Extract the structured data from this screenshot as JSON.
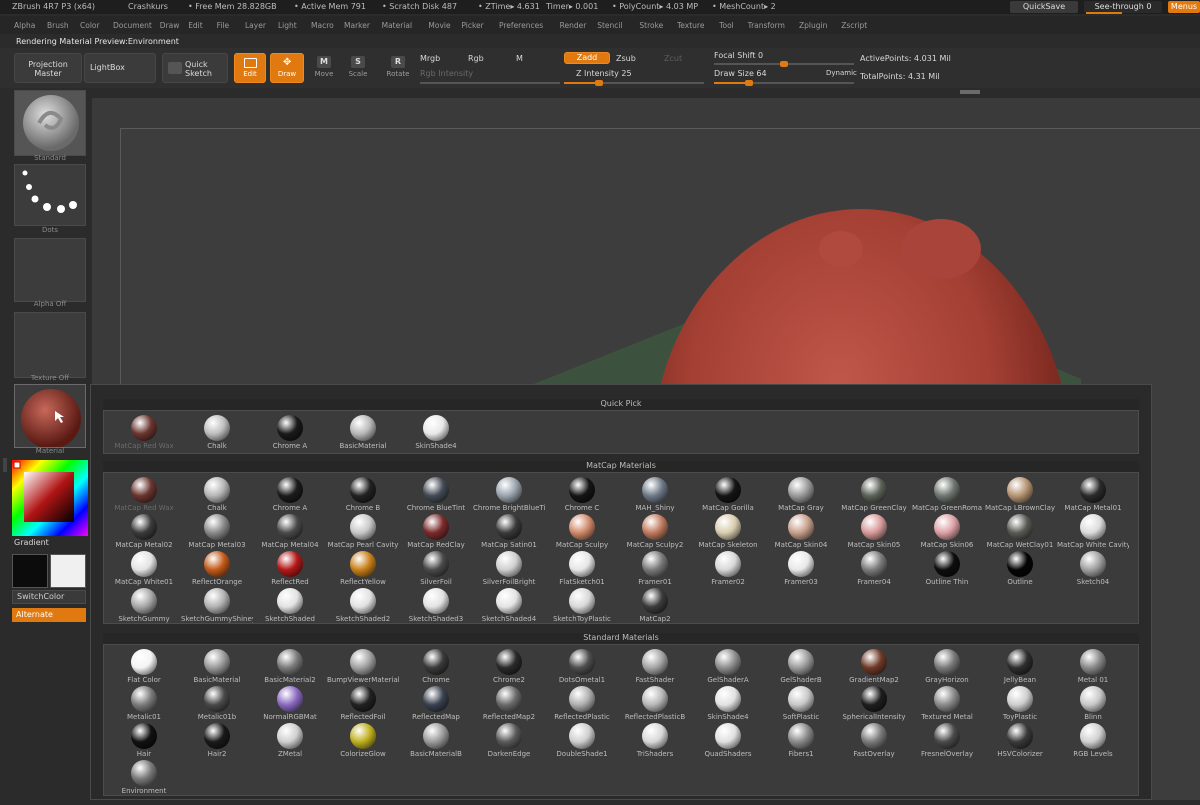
{
  "titlebar": {
    "app": "ZBrush 4R7 P3 (x64)",
    "project": "Crashkurs",
    "free_mem": "• Free Mem 28.828GB",
    "active_mem": "• Active Mem 791",
    "scratch_disk": "• Scratch Disk 487",
    "ztime": "• ZTime▸ 4.631",
    "timer": "Timer▸ 0.001",
    "polycount": "• PolyCount▸ 4.03 MP",
    "meshcount": "• MeshCount▸ 2",
    "quicksave": "QuickSave",
    "seethrough": "See-through 0",
    "menus": "Menus"
  },
  "menubar": [
    "Alpha",
    "Brush",
    "Color",
    "Document",
    "Draw",
    "Edit",
    "File",
    "Layer",
    "Light",
    "Macro",
    "Marker",
    "Material",
    "Movie",
    "Picker",
    "Preferences",
    "Render",
    "Stencil",
    "Stroke",
    "Texture",
    "Tool",
    "Transform",
    "Zplugin",
    "Zscript"
  ],
  "subtitle": "Rendering Material Preview:Environment",
  "shelf": {
    "projection_master": "Projection Master",
    "lightbox": "LightBox",
    "quick_sketch": "Quick Sketch",
    "edit": "Edit",
    "draw": "Draw",
    "move": "Move",
    "scale": "Scale",
    "rotate": "Rotate",
    "mrgb": "Mrgb",
    "rgb": "Rgb",
    "m": "M",
    "rgb_intensity": "Rgb Intensity",
    "zadd": "Zadd",
    "zsub": "Zsub",
    "zcut": "Zcut",
    "z_intensity": "Z Intensity 25",
    "focal_shift": "Focal Shift 0",
    "draw_size": "Draw Size 64",
    "dynamic": "Dynamic",
    "active_points": "ActivePoints: 4.031 Mil",
    "total_points": "TotalPoints: 4.31 Mil",
    "z_intensity_value": 25,
    "draw_size_value": 64
  },
  "left": {
    "standard": "Standard",
    "dots": "Dots",
    "alpha_off": "Alpha Off",
    "texture_off": "Texture Off",
    "material": "Material",
    "gradient": "Gradient",
    "switchcolor": "SwitchColor",
    "alternate": "Alternate"
  },
  "popup": {
    "quick_pick_title": "Quick Pick",
    "matcap_title": "MatCap Materials",
    "standard_title": "Standard Materials",
    "quick_pick": [
      {
        "label": "MatCap Red Wax",
        "color": "#6a3530",
        "dim": true
      },
      {
        "label": "Chalk",
        "color": "#bdbdbd"
      },
      {
        "label": "Chrome A",
        "color": "#1a1a1a"
      },
      {
        "label": "BasicMaterial",
        "color": "#b8b8b8"
      },
      {
        "label": "SkinShade4",
        "color": "#e8e8e8"
      }
    ],
    "matcap": [
      {
        "label": "MatCap Red Wax",
        "color": "#6a3530",
        "dim": true
      },
      {
        "label": "Chalk",
        "color": "#b5b5b5"
      },
      {
        "label": "Chrome A",
        "color": "#1c1c1c"
      },
      {
        "label": "Chrome B",
        "color": "#222"
      },
      {
        "label": "Chrome BlueTint",
        "color": "#444b55"
      },
      {
        "label": "Chrome BrightBlueTi",
        "color": "#9aa3ad"
      },
      {
        "label": "Chrome C",
        "color": "#151515"
      },
      {
        "label": "MAH_Shiny",
        "color": "#6f7a88"
      },
      {
        "label": "MatCap Gorilla",
        "color": "#141414"
      },
      {
        "label": "MatCap Gray",
        "color": "#9a9a9a"
      },
      {
        "label": "MatCap GreenClay",
        "color": "#5b6358"
      },
      {
        "label": "MatCap GreenRoma",
        "color": "#6f7670"
      },
      {
        "label": "MatCap LBrownClay",
        "color": "#b59472"
      },
      {
        "label": "MatCap Metal01",
        "color": "#2a2a2a"
      },
      {
        "label": "MatCap Metal02",
        "color": "#3a3a3a"
      },
      {
        "label": "MatCap Metal03",
        "color": "#8a8a8a"
      },
      {
        "label": "MatCap Metal04",
        "color": "#4a4a4a"
      },
      {
        "label": "MatCap Pearl Cavity",
        "color": "#c8c8c8"
      },
      {
        "label": "MatCap RedClay",
        "color": "#7a2a2a"
      },
      {
        "label": "MatCap Satin01",
        "color": "#3a3a3a"
      },
      {
        "label": "MatCap Sculpy",
        "color": "#d08a6a"
      },
      {
        "label": "MatCap Sculpy2",
        "color": "#c07a5f"
      },
      {
        "label": "MatCap Skeleton",
        "color": "#d8cdb0"
      },
      {
        "label": "MatCap Skin04",
        "color": "#c7a08c"
      },
      {
        "label": "MatCap Skin05",
        "color": "#d79a9a"
      },
      {
        "label": "MatCap Skin06",
        "color": "#dca0a5"
      },
      {
        "label": "MatCap WetClay01",
        "color": "#5a5a55"
      },
      {
        "label": "MatCap White Cavity",
        "color": "#dcdcdc"
      },
      {
        "label": "MatCap White01",
        "color": "#e4e4e4"
      },
      {
        "label": "ReflectOrange",
        "color": "#c25a1a"
      },
      {
        "label": "ReflectRed",
        "color": "#b41818"
      },
      {
        "label": "ReflectYellow",
        "color": "#c8801a"
      },
      {
        "label": "SilverFoil",
        "color": "#4a4a4a"
      },
      {
        "label": "SilverFoilBright",
        "color": "#d0d0d0"
      },
      {
        "label": "FlatSketch01",
        "color": "#e6e6e6"
      },
      {
        "label": "Framer01",
        "color": "#7a7a7a"
      },
      {
        "label": "Framer02",
        "color": "#d8d8d8"
      },
      {
        "label": "Framer03",
        "color": "#e8e8e8"
      },
      {
        "label": "Framer04",
        "color": "#7c7c7c"
      },
      {
        "label": "Outline Thin",
        "color": "#0e0e0e"
      },
      {
        "label": "Outline",
        "color": "#050505"
      },
      {
        "label": "Sketch04",
        "color": "#a0a0a0"
      },
      {
        "label": "SketchGummy",
        "color": "#a8a8a8"
      },
      {
        "label": "SketchGummyShiney",
        "color": "#b2b2b2"
      },
      {
        "label": "SketchShaded",
        "color": "#e2e2e2"
      },
      {
        "label": "SketchShaded2",
        "color": "#e2e2e2"
      },
      {
        "label": "SketchShaded3",
        "color": "#e2e2e2"
      },
      {
        "label": "SketchShaded4",
        "color": "#e4e4e4"
      },
      {
        "label": "SketchToyPlastic",
        "color": "#d8d8d8"
      },
      {
        "label": "MatCap2",
        "color": "#3b3b3b"
      }
    ],
    "standard": [
      {
        "label": "Flat Color",
        "color": "#f4f4f4"
      },
      {
        "label": "BasicMaterial",
        "color": "#9a9a9a"
      },
      {
        "label": "BasicMaterial2",
        "color": "#7a7a7a"
      },
      {
        "label": "BumpViewerMaterial",
        "color": "#a2a2a2"
      },
      {
        "label": "Chrome",
        "color": "#3a3a3a"
      },
      {
        "label": "Chrome2",
        "color": "#2a2a2a"
      },
      {
        "label": "DotsOmetal1",
        "color": "#4e4e4e"
      },
      {
        "label": "FastShader",
        "color": "#a5a5a5"
      },
      {
        "label": "GelShaderA",
        "color": "#8e8e8e"
      },
      {
        "label": "GelShaderB",
        "color": "#9c9c9c"
      },
      {
        "label": "GradientMap2",
        "color": "#6e3a28"
      },
      {
        "label": "GrayHorizon",
        "color": "#7a7a7a"
      },
      {
        "label": "JellyBean",
        "color": "#2e2e2e"
      },
      {
        "label": "Metal 01",
        "color": "#8a8a8a"
      },
      {
        "label": "Metalic01",
        "color": "#7c7c7c"
      },
      {
        "label": "Metalic01b",
        "color": "#4a4a4a"
      },
      {
        "label": "NormalRGBMat",
        "color": "#8a6ac0"
      },
      {
        "label": "ReflectedFoil",
        "color": "#222"
      },
      {
        "label": "ReflectedMap",
        "color": "#3a4250"
      },
      {
        "label": "ReflectedMap2",
        "color": "#6a6a6a"
      },
      {
        "label": "ReflectedPlastic",
        "color": "#b0b0b0"
      },
      {
        "label": "ReflectedPlasticB",
        "color": "#b8b8b8"
      },
      {
        "label": "SkinShade4",
        "color": "#e2e2e2"
      },
      {
        "label": "SoftPlastic",
        "color": "#c8c8c8"
      },
      {
        "label": "SphericalIntensity",
        "color": "#1e1e1e"
      },
      {
        "label": "Textured Metal",
        "color": "#8a8a8a"
      },
      {
        "label": "ToyPlastic",
        "color": "#cfcfcf"
      },
      {
        "label": "Blinn",
        "color": "#c8c8c8"
      },
      {
        "label": "Hair",
        "color": "#111"
      },
      {
        "label": "Hair2",
        "color": "#1a1a1a"
      },
      {
        "label": "ZMetal",
        "color": "#cfcfcf"
      },
      {
        "label": "ColorizeGlow",
        "color": "#c0b020"
      },
      {
        "label": "BasicMaterialB",
        "color": "#9c9c9c"
      },
      {
        "label": "DarkenEdge",
        "color": "#5a5a5a"
      },
      {
        "label": "DoubleShade1",
        "color": "#cfcfcf"
      },
      {
        "label": "TriShaders",
        "color": "#d8d8d8"
      },
      {
        "label": "QuadShaders",
        "color": "#e0e0e0"
      },
      {
        "label": "Fibers1",
        "color": "#8a8a8a"
      },
      {
        "label": "FastOverlay",
        "color": "#7a7a7a"
      },
      {
        "label": "FresnelOverlay",
        "color": "#4a4a4a"
      },
      {
        "label": "HSVColorizer",
        "color": "#3a3a3a"
      },
      {
        "label": "RGB Levels",
        "color": "#d0d0d0"
      },
      {
        "label": "Environment",
        "color": "#7a7a7a"
      }
    ]
  },
  "colors": {
    "accent": "#e0790f",
    "model": "#a33f33",
    "background": "#2b2b2b"
  }
}
